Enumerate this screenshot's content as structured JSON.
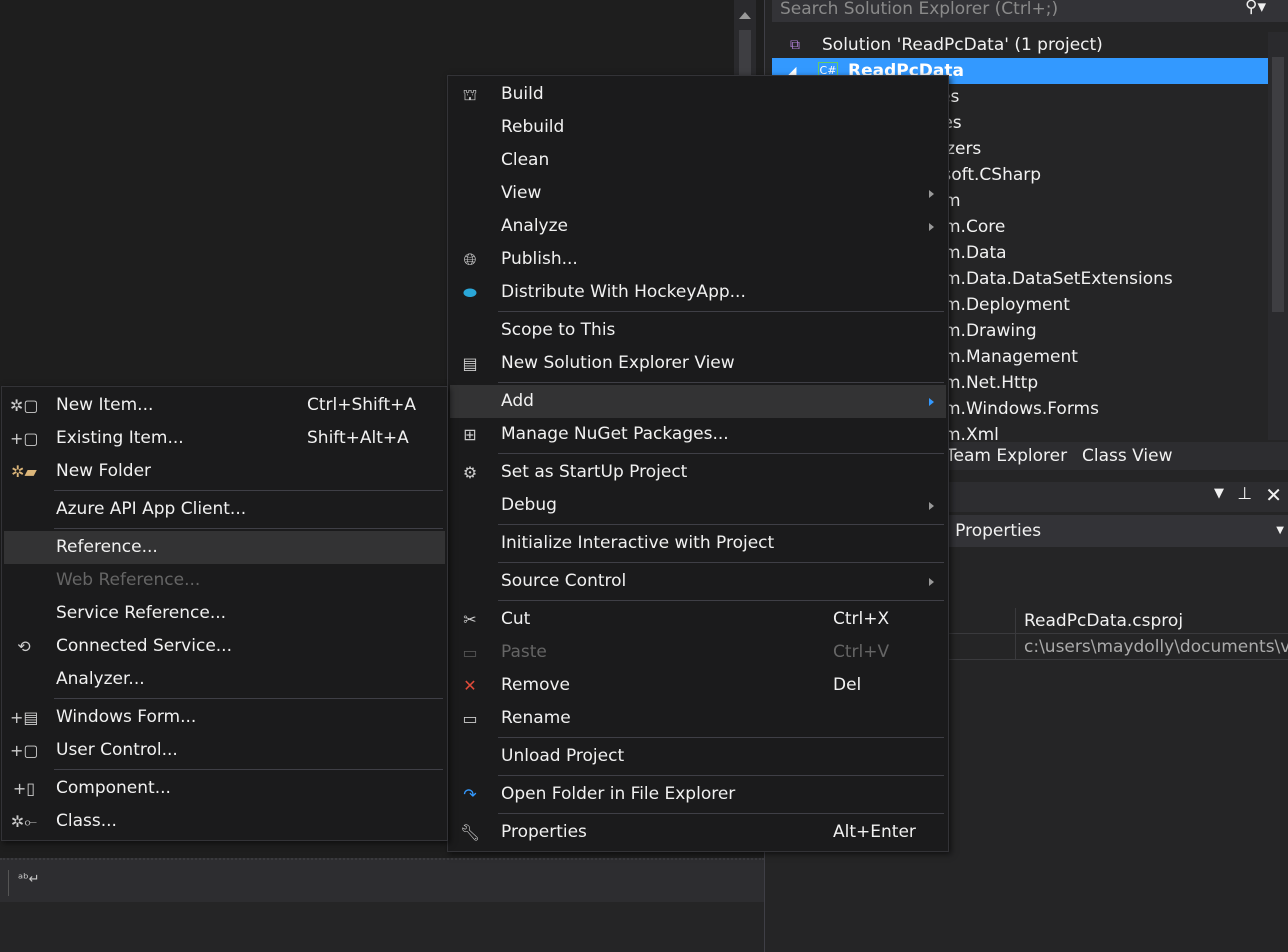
{
  "solution_explorer": {
    "search_placeholder": "Search Solution Explorer (Ctrl+;)",
    "search_icon": "magnifier-icon",
    "solution_label": "Solution 'ReadPcData' (1 project)",
    "project_label": "ReadPcData",
    "visible_fragments": [
      "es",
      "ces",
      "yzers",
      "osoft.CSharp",
      "m",
      "m.Core",
      "m.Data",
      "m.Data.DataSetExtensions",
      "m.Deployment",
      "m.Drawing",
      "m.Management",
      "m.Net.Http",
      "m.Windows.Forms",
      "m.Xml"
    ]
  },
  "tabs": {
    "team_explorer": "Team Explorer",
    "class_view": "Class View"
  },
  "properties": {
    "title_fragment": ": Properties",
    "rows": [
      {
        "value": "ReadPcData.csproj"
      },
      {
        "value": "c:\\users\\maydolly\\documents\\v"
      }
    ]
  },
  "context_menu": {
    "items": [
      {
        "label": "Build",
        "icon": "build-icon"
      },
      {
        "label": "Rebuild"
      },
      {
        "label": "Clean"
      },
      {
        "label": "View",
        "submenu": true
      },
      {
        "label": "Analyze",
        "submenu": true
      },
      {
        "label": "Publish...",
        "icon": "globe-icon"
      },
      {
        "label": "Distribute With HockeyApp...",
        "icon": "hockeyapp-icon"
      },
      {
        "sep": true
      },
      {
        "label": "Scope to This"
      },
      {
        "label": "New Solution Explorer View",
        "icon": "new-view-icon"
      },
      {
        "sep": true
      },
      {
        "label": "Add",
        "submenu": true,
        "highlighted": true
      },
      {
        "label": "Manage NuGet Packages...",
        "icon": "nuget-icon"
      },
      {
        "sep": true
      },
      {
        "label": "Set as StartUp Project",
        "icon": "gear-icon"
      },
      {
        "label": "Debug",
        "submenu": true
      },
      {
        "sep": true
      },
      {
        "label": "Initialize Interactive with Project"
      },
      {
        "sep": true
      },
      {
        "label": "Source Control",
        "submenu": true
      },
      {
        "sep": true
      },
      {
        "label": "Cut",
        "icon": "scissors-icon",
        "shortcut": "Ctrl+X"
      },
      {
        "label": "Paste",
        "icon": "paste-icon",
        "shortcut": "Ctrl+V",
        "disabled": true
      },
      {
        "label": "Remove",
        "icon": "remove-icon",
        "shortcut": "Del"
      },
      {
        "label": "Rename",
        "icon": "rename-icon"
      },
      {
        "sep": true
      },
      {
        "label": "Unload Project"
      },
      {
        "sep": true
      },
      {
        "label": "Open Folder in File Explorer",
        "icon": "open-folder-arrow-icon"
      },
      {
        "sep": true
      },
      {
        "label": "Properties",
        "icon": "wrench-icon",
        "shortcut": "Alt+Enter"
      }
    ]
  },
  "add_submenu": {
    "items": [
      {
        "label": "New Item...",
        "icon": "new-item-icon",
        "shortcut": "Ctrl+Shift+A"
      },
      {
        "label": "Existing Item...",
        "icon": "existing-item-icon",
        "shortcut": "Shift+Alt+A"
      },
      {
        "label": "New Folder",
        "icon": "new-folder-icon"
      },
      {
        "sep": true
      },
      {
        "label": "Azure API App Client..."
      },
      {
        "sep": true
      },
      {
        "label": "Reference...",
        "highlighted": true
      },
      {
        "label": "Web Reference...",
        "disabled": true
      },
      {
        "label": "Service Reference..."
      },
      {
        "label": "Connected Service...",
        "icon": "connected-service-icon"
      },
      {
        "label": "Analyzer..."
      },
      {
        "sep": true
      },
      {
        "label": "Windows Form...",
        "icon": "windows-form-icon"
      },
      {
        "label": "User Control...",
        "icon": "user-control-icon"
      },
      {
        "sep": true
      },
      {
        "label": "Component...",
        "icon": "component-icon"
      },
      {
        "label": "Class...",
        "icon": "class-icon"
      }
    ]
  },
  "bottom_toolbar": {
    "icon": "word-wrap-icon"
  },
  "colors": {
    "selection": "#3399ff",
    "menu_bg": "#1b1b1c",
    "highlight": "#333334",
    "remove_red": "#e04b3a",
    "arrow_blue": "#3399ff"
  }
}
